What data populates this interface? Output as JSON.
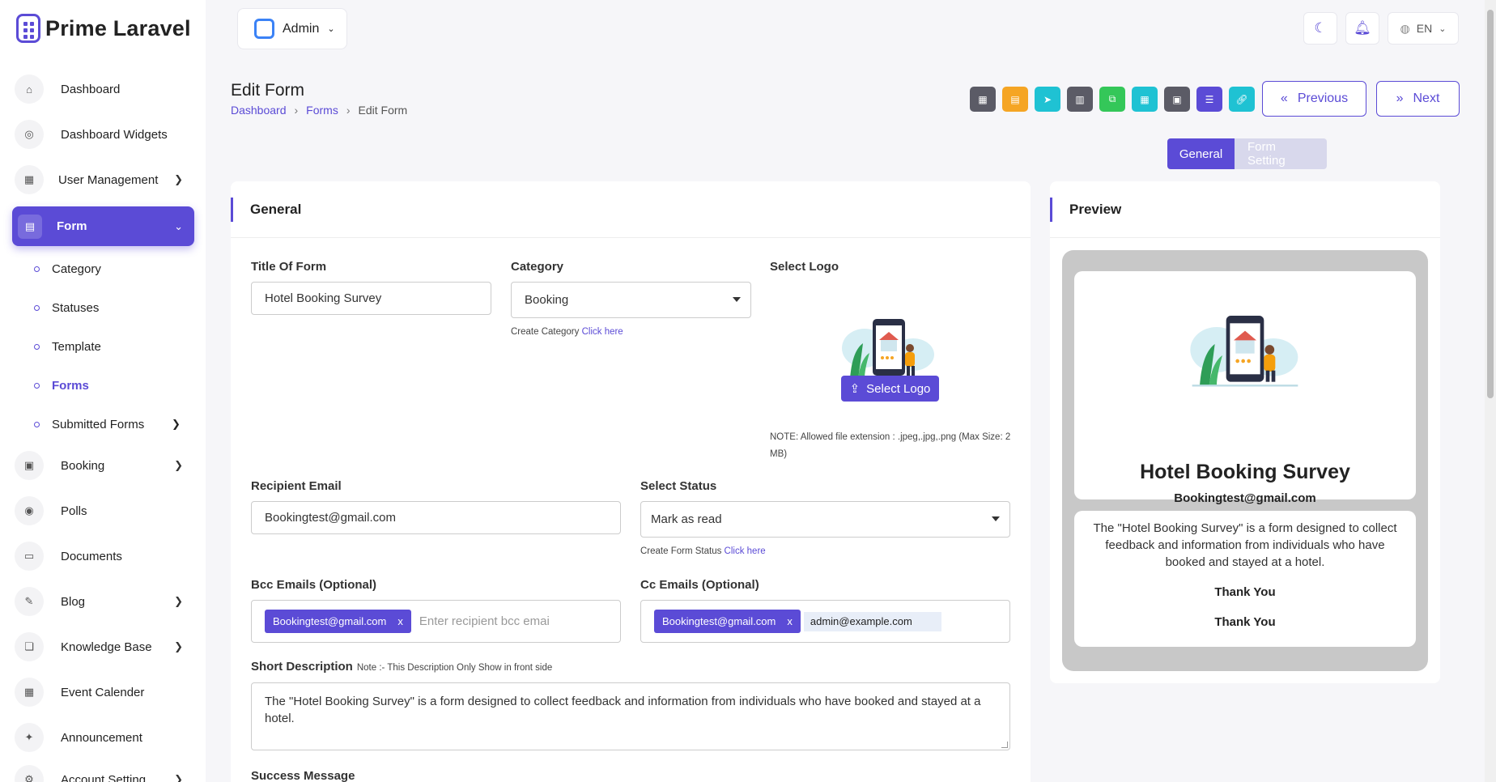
{
  "app": {
    "brand": "Prime Laravel"
  },
  "topbar": {
    "role": "Admin",
    "language": "EN"
  },
  "sidebar": {
    "items": [
      {
        "label": "Dashboard",
        "icon": "home-icon"
      },
      {
        "label": "Dashboard Widgets",
        "icon": "gauge-icon"
      },
      {
        "label": "User Management",
        "icon": "grid-icon"
      },
      {
        "label": "Form",
        "icon": "table-icon"
      },
      {
        "label": "Booking",
        "icon": "booking-icon"
      },
      {
        "label": "Polls",
        "icon": "poll-icon"
      },
      {
        "label": "Documents",
        "icon": "document-icon"
      },
      {
        "label": "Blog",
        "icon": "blog-icon"
      },
      {
        "label": "Knowledge Base",
        "icon": "book-icon"
      },
      {
        "label": "Event Calender",
        "icon": "calendar-icon"
      },
      {
        "label": "Announcement",
        "icon": "megaphone-icon"
      },
      {
        "label": "Account Setting",
        "icon": "settings-icon"
      }
    ],
    "form_sub": [
      "Category",
      "Statuses",
      "Template",
      "Forms",
      "Submitted Forms"
    ]
  },
  "header": {
    "title": "Edit Form",
    "breadcrumb": [
      "Dashboard",
      "Forms",
      "Edit Form"
    ],
    "previous": "Previous",
    "next": "Next"
  },
  "tabs": [
    "General",
    "Form Setting"
  ],
  "form": {
    "section_title": "General",
    "title_label": "Title Of Form",
    "title_value": "Hotel Booking Survey",
    "category_label": "Category",
    "category_value": "Booking",
    "create_category_text": "Create Category",
    "click_here": "Click here",
    "logo_label": "Select Logo",
    "logo_button": "Select Logo",
    "logo_note": "NOTE: Allowed file extension : .jpeg,.jpg,.png (Max Size: 2 MB)",
    "recipient_label": "Recipient Email",
    "recipient_value": "Bookingtest@gmail.com",
    "status_label": "Select Status",
    "status_value": "Mark as read",
    "create_status_text": "Create Form Status",
    "bcc_label": "Bcc Emails (Optional)",
    "bcc_chip": "Bookingtest@gmail.com",
    "bcc_placeholder": "Enter recipient bcc emai",
    "cc_label": "Cc Emails (Optional)",
    "cc_chip": "Bookingtest@gmail.com",
    "cc_input": "admin@example.com",
    "short_desc_label": "Short Description",
    "short_desc_note": "Note :- This Description Only Show in front side",
    "short_desc_value": "The \"Hotel Booking Survey\" is a form designed to collect feedback and information from individuals who have booked and stayed at a hotel.",
    "success_label": "Success Message"
  },
  "preview": {
    "section_title": "Preview",
    "title": "Hotel Booking Survey",
    "email": "Bookingtest@gmail.com",
    "description": "The \"Hotel Booking Survey\" is a form designed to collect feedback and information from individuals who have booked and stayed at a hotel.",
    "thanks_1": "Thank You",
    "thanks_2": "Thank You"
  },
  "colors": {
    "accent": "#5b4bd6",
    "toolbar": [
      "#5b5b66",
      "#f5a524",
      "#1fc2d3",
      "#5b5b66",
      "#34c759",
      "#1fc2d3",
      "#5b5b66",
      "#5b4bd6",
      "#1fc2d3"
    ]
  }
}
